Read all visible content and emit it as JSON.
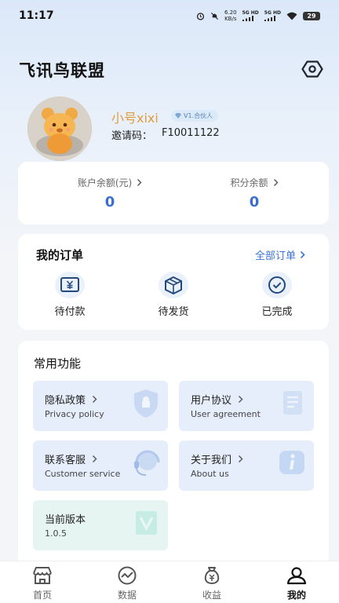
{
  "status_bar": {
    "time": "11:17",
    "speed_value": "6.20",
    "speed_unit": "KB/s",
    "net1": "5G HD",
    "net2": "5G HD",
    "battery": "29"
  },
  "header": {
    "title": "飞讯鸟联盟",
    "settings_icon": "settings-hexagon-icon"
  },
  "profile": {
    "nickname": "小号xixi",
    "level_badge": "V1.合伙人",
    "invite_label": "邀请码：",
    "invite_code": "F10011122"
  },
  "balances": {
    "account_label": "账户余额(元)",
    "account_value": "0",
    "points_label": "积分余额",
    "points_value": "0"
  },
  "orders": {
    "title": "我的订单",
    "all_label": "全部订单",
    "items": [
      {
        "label": "待付款",
        "icon": "yuan-wallet-icon"
      },
      {
        "label": "待发货",
        "icon": "package-box-icon"
      },
      {
        "label": "已完成",
        "icon": "check-circle-icon"
      }
    ]
  },
  "functions": {
    "title": "常用功能",
    "tiles": [
      {
        "title": "隐私政策",
        "subtitle": "Privacy policy",
        "icon": "shield-icon"
      },
      {
        "title": "用户协议",
        "subtitle": "User agreement",
        "icon": "document-icon"
      },
      {
        "title": "联系客服",
        "subtitle": "Customer service",
        "icon": "headset-icon"
      },
      {
        "title": "关于我们",
        "subtitle": "About us",
        "icon": "info-icon"
      },
      {
        "title": "当前版本",
        "subtitle": "1.0.5",
        "icon": "version-v-icon"
      }
    ]
  },
  "tabbar": {
    "items": [
      {
        "label": "首页",
        "icon": "store-icon"
      },
      {
        "label": "数据",
        "icon": "chart-icon"
      },
      {
        "label": "收益",
        "icon": "money-bag-icon"
      },
      {
        "label": "我的",
        "icon": "user-icon"
      }
    ],
    "active_index": 3
  },
  "colors": {
    "accent": "#3a6fd0",
    "nickname": "#e29b3e"
  }
}
